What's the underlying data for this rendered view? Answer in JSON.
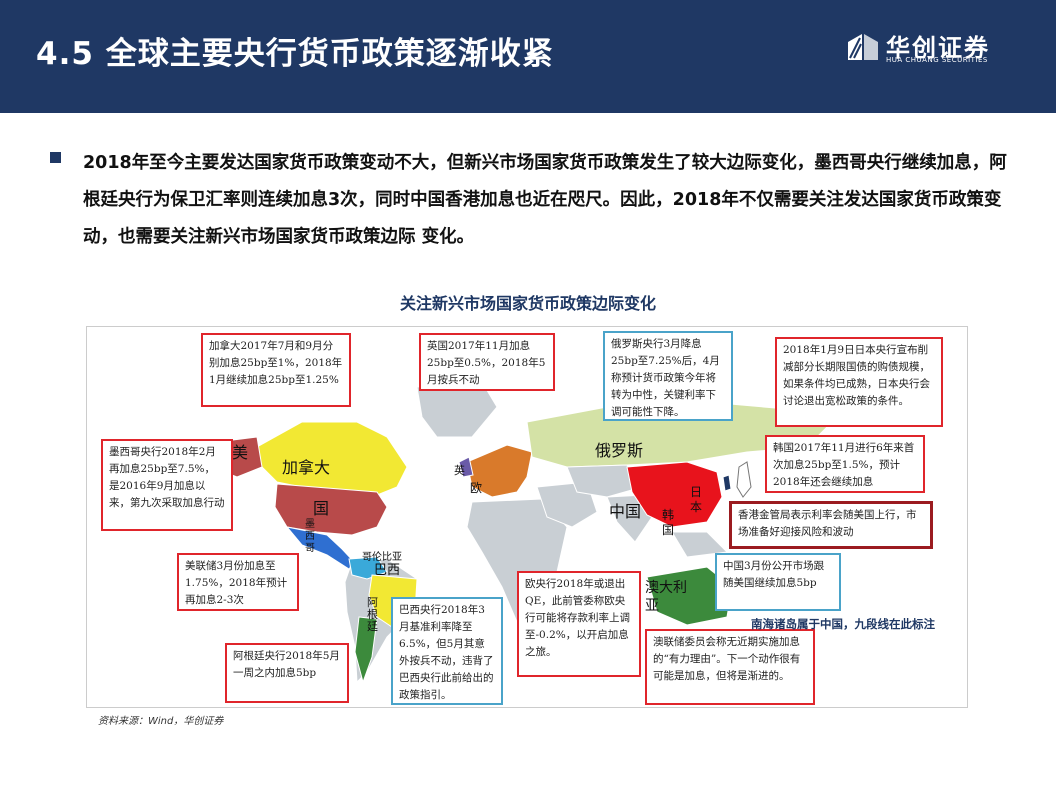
{
  "header": {
    "title": "4.5 全球主要央行货币政策逐渐收紧",
    "logo_cn": "华创证券",
    "logo_en": "HUA CHUANG SECURITIES"
  },
  "bullet": {
    "text": "2018年至今主要发达国家货币政策变动不大，但新兴市场国家货币政策发生了较大边际变化，墨西哥央行继续加息，阿根廷央行为保卫汇率则连续加息3次，同时中国香港加息也近在咫尺。因此，2018年不仅需要关注发达国家货币政策变动，也需要关注新兴市场国家货币政策边际 变化。"
  },
  "figure": {
    "title": "关注新兴市场国家货币政策边际变化",
    "source": "资料来源：Wind，华创证券",
    "map_labels": {
      "usa_1": "美",
      "usa_2": "国",
      "canada": "加拿大",
      "mexico": "墨西哥",
      "colombia": "哥伦比亚",
      "brazil": "巴西",
      "argentina": "阿根廷",
      "uk": "英",
      "eu": "欧",
      "russia": "俄罗斯",
      "china": "中国",
      "korea": "韩国",
      "japan": "日本",
      "australia": "澳大利亚"
    },
    "callouts": {
      "canada": "加拿大2017年7月和9月分别加息25bp至1%，2018年1月继续加息25bp至1.25%",
      "uk": "英国2017年11月加息25bp至0.5%，2018年5月按兵不动",
      "russia": "俄罗斯央行3月降息25bp至7.25%后，4月称预计货币政策今年将转为中性，关键利率下调可能性下降。",
      "japan": "2018年1月9日日本央行宣布削减部分长期限国债的购债规模，如果条件均已成熟，日本央行会讨论退出宽松政策的条件。",
      "mexico": "墨西哥央行2018年2月再加息25bp至7.5%，是2016年9月加息以来，第九次采取加息行动",
      "korea": "韩国2017年11月进行6年来首次加息25bp至1.5%，预计2018年还会继续加息",
      "hongkong": "香港金管局表示利率会随美国上行，市场准备好迎接风险和波动",
      "fed": "美联储3月份加息至1.75%，2018年预计再加息2-3次",
      "china": "中国3月份公开市场跟随美国继续加息5bp",
      "ecb": "欧央行2018年或退出QE，此前管委称欧央行可能将存款利率上调至-0.2%，以开启加息之旅。",
      "brazil": "巴西央行2018年3月基准利率降至6.5%，但5月其意外按兵不动，违背了巴西央行此前给出的政策指引。",
      "argentina": "阿根廷央行2018年5月一周之内加息5bp",
      "australia": "澳联储委员会称无近期实施加息的“有力理由”。下一个动作很有可能是加息，但将是渐进的。"
    },
    "south_sea_note": "南海诸岛属于中国，九段线在此标注",
    "colors": {
      "header_bg": "#1f3864",
      "callout_red": "#e0252b",
      "callout_blue": "#4aa3c9",
      "usa": "#b84a4a",
      "canada": "#f2e833",
      "china": "#e8131c",
      "russia": "#d4e2a6",
      "ocean": "#ffffff",
      "land": "#c9cfd4"
    }
  }
}
